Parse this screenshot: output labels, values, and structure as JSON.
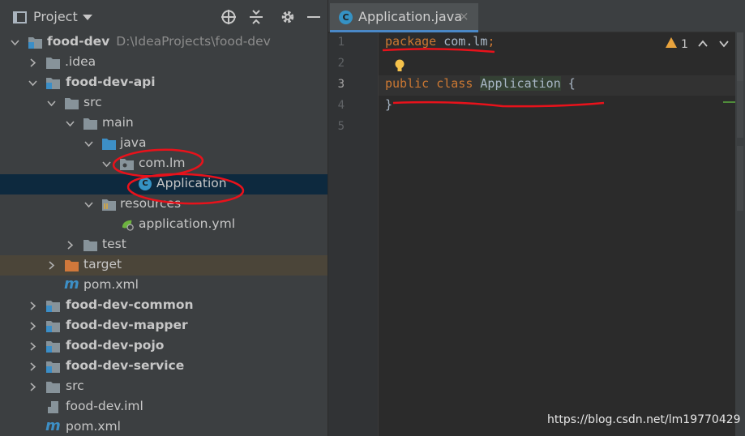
{
  "project_panel": {
    "title": "Project",
    "tree": [
      {
        "label": "food-dev",
        "path": "D:\\IdeaProjects\\food-dev",
        "bold": true
      },
      {
        "label": ".idea"
      },
      {
        "label": "food-dev-api",
        "bold": true
      },
      {
        "label": "src"
      },
      {
        "label": "main"
      },
      {
        "label": "java"
      },
      {
        "label": "com.lm"
      },
      {
        "label": "Application"
      },
      {
        "label": "resources"
      },
      {
        "label": "application.yml"
      },
      {
        "label": "test"
      },
      {
        "label": "target"
      },
      {
        "label": "pom.xml"
      },
      {
        "label": "food-dev-common",
        "bold": true
      },
      {
        "label": "food-dev-mapper",
        "bold": true
      },
      {
        "label": "food-dev-pojo",
        "bold": true
      },
      {
        "label": "food-dev-service",
        "bold": true
      },
      {
        "label": "src"
      },
      {
        "label": "food-dev.iml"
      },
      {
        "label": "pom.xml"
      }
    ]
  },
  "editor": {
    "tab": {
      "label": "Application.java",
      "close": "×"
    },
    "line_numbers": [
      "1",
      "2",
      "3",
      "4",
      "5"
    ],
    "code": {
      "line1_kw": "package",
      "line1_rest": " com.lm",
      "line1_semi": ";",
      "line3_kw": "public class",
      "line3_cls": "Application",
      "line3_rest": " {",
      "line4": "}"
    },
    "warning_count": "1"
  },
  "watermark": "https://blog.csdn.net/lm19770429",
  "colors": {
    "selection": "#0d293e",
    "accent": "#4a88c7",
    "keyword": "#cc7832",
    "annotation": "#e8121b"
  }
}
